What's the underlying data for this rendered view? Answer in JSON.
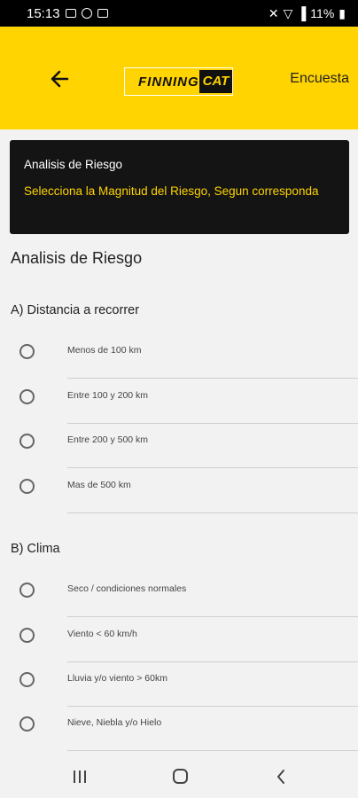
{
  "status_bar": {
    "time": "15:13",
    "battery": "11%"
  },
  "app_bar": {
    "title": "Encuesta",
    "logo_text": "FINNING",
    "logo_badge": "CAT"
  },
  "info_card": {
    "title": "Analisis de Riesgo",
    "subtitle": "Selecciona la Magnitud del Riesgo, Segun corresponda"
  },
  "section_title": "Analisis de Riesgo",
  "questions": [
    {
      "title": "A) Distancia a recorrer",
      "options": [
        "Menos de 100 km",
        "Entre 100 y 200 km",
        "Entre 200 y 500 km",
        "Mas de 500 km"
      ]
    },
    {
      "title": "B) Clima",
      "options": [
        "Seco / condiciones normales",
        "Viento < 60 km/h",
        "Lluvia y/o viento > 60km",
        "Nieve, Niebla y/o Hielo"
      ]
    }
  ],
  "colors": {
    "accent": "#ffd400",
    "card_bg": "#141414",
    "background": "#f2f2f2"
  }
}
